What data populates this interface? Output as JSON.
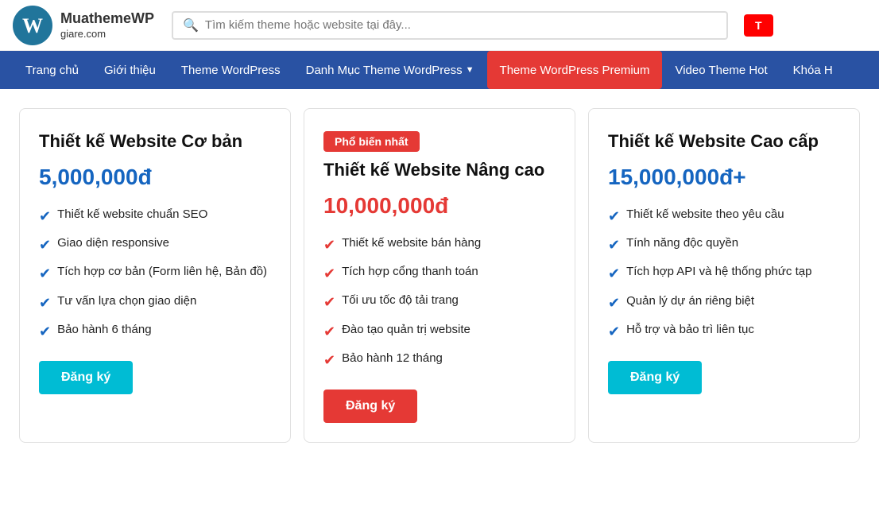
{
  "header": {
    "logo_brand": "MuathemeWP",
    "logo_domain": "giare.com",
    "search_placeholder": "Tìm kiếm theme hoặc website tại đây...",
    "top_label": "T"
  },
  "navbar": {
    "items": [
      {
        "id": "trang-chu",
        "label": "Trang chủ",
        "active": false,
        "has_chevron": false
      },
      {
        "id": "gioi-thieu",
        "label": "Giới thiệu",
        "active": false,
        "has_chevron": false
      },
      {
        "id": "theme-wordpress",
        "label": "Theme WordPress",
        "active": false,
        "has_chevron": false
      },
      {
        "id": "danh-muc",
        "label": "Danh Mục Theme WordPress",
        "active": false,
        "has_chevron": true
      },
      {
        "id": "premium",
        "label": "Theme WordPress Premium",
        "active": true,
        "has_chevron": false
      },
      {
        "id": "video-theme",
        "label": "Video Theme Hot",
        "active": false,
        "has_chevron": false
      },
      {
        "id": "khoa-hoc",
        "label": "Khóa H",
        "active": false,
        "has_chevron": false
      }
    ]
  },
  "pricing": {
    "cards": [
      {
        "id": "basic",
        "title": "Thiết kế Website Cơ bản",
        "price": "5,000,000đ",
        "price_color": "blue",
        "popular": false,
        "features": [
          "Thiết kế website chuẩn SEO",
          "Giao diện responsive",
          "Tích hợp cơ bản (Form liên hệ, Bản đồ)",
          "Tư vấn lựa chọn giao diện",
          "Bảo hành 6 tháng"
        ],
        "check_color": "blue",
        "btn_label": "Đăng ký",
        "btn_color": "cyan"
      },
      {
        "id": "advanced",
        "title": "Thiết kế Website Nâng cao",
        "price": "10,000,000đ",
        "price_color": "red",
        "popular": true,
        "popular_label": "Phổ biến nhất",
        "features": [
          "Thiết kế website bán hàng",
          "Tích hợp cổng thanh toán",
          "Tối ưu tốc độ tải trang",
          "Đào tạo quản trị website",
          "Bảo hành 12 tháng"
        ],
        "check_color": "red",
        "btn_label": "Đăng ký",
        "btn_color": "red"
      },
      {
        "id": "premium",
        "title": "Thiết kế Website Cao cấp",
        "price": "15,000,000đ+",
        "price_color": "blue",
        "popular": false,
        "features": [
          "Thiết kế website theo yêu cầu",
          "Tính năng độc quyền",
          "Tích hợp API và hệ thống phức tạp",
          "Quản lý dự án riêng biệt",
          "Hỗ trợ và bảo trì liên tục"
        ],
        "check_color": "blue",
        "btn_label": "Đăng ký",
        "btn_color": "cyan"
      }
    ]
  }
}
